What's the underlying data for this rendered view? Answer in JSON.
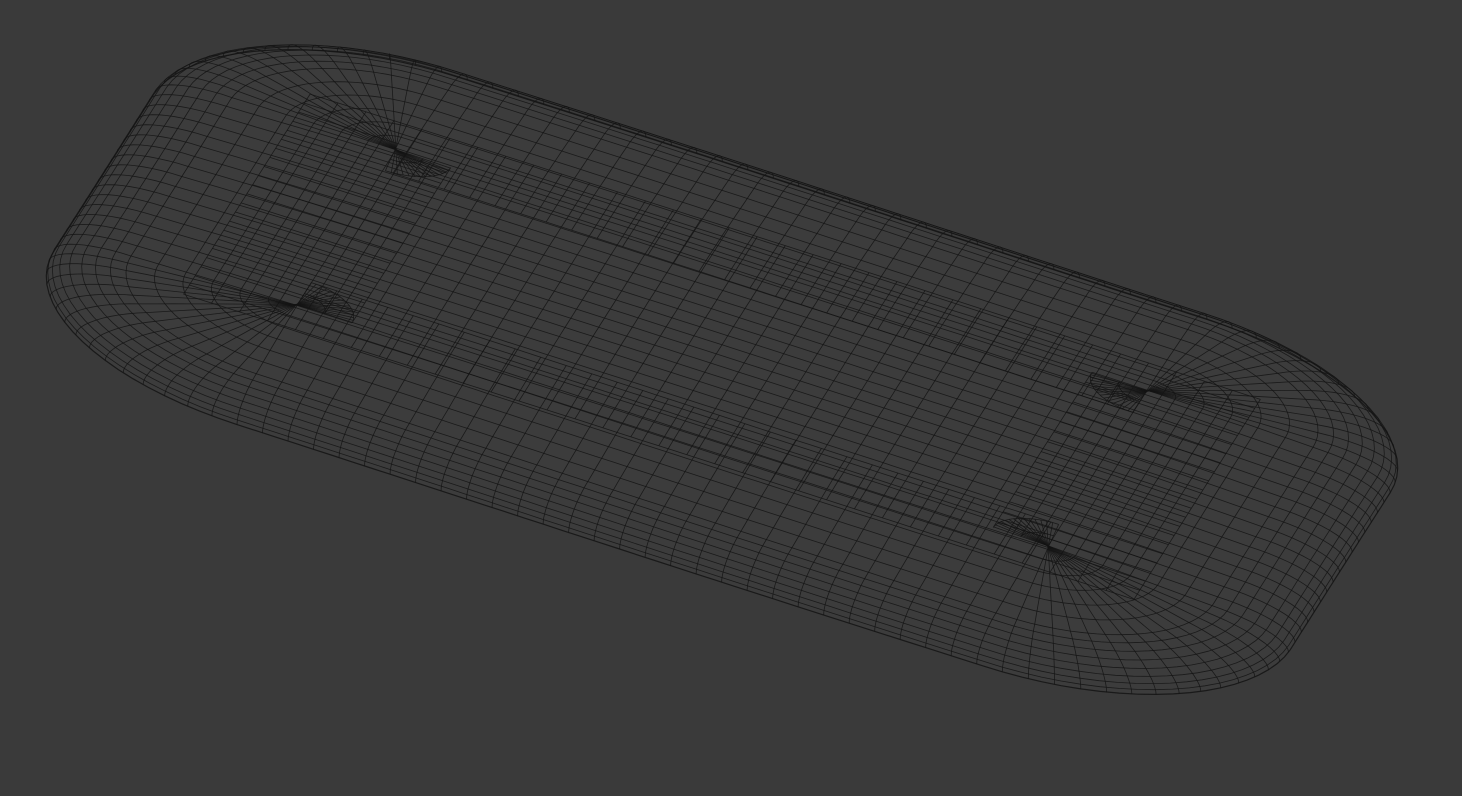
{
  "viewport": {
    "background": "#3a3a3a",
    "wire_color": "#141414",
    "object": {
      "type": "wireframe-mesh",
      "shape": "rounded-slab",
      "surface_color": "#3c3c3c"
    }
  }
}
